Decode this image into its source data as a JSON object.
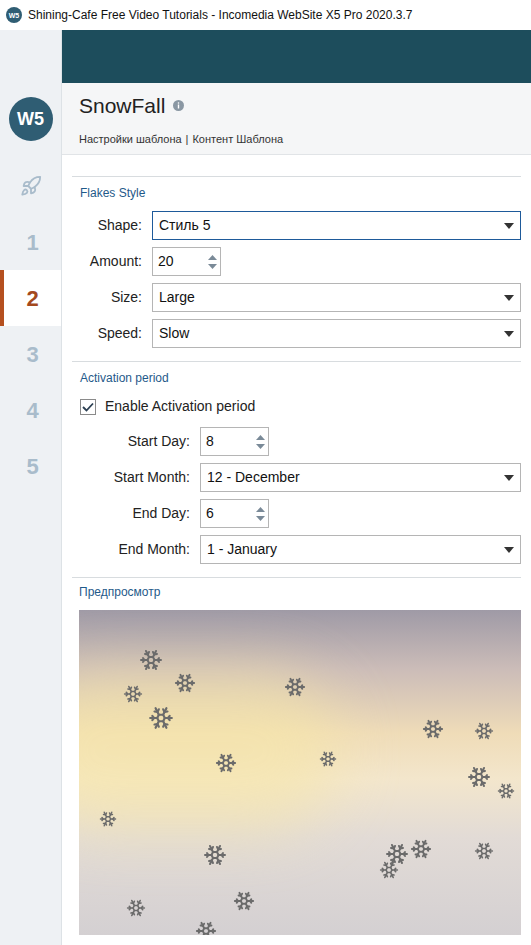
{
  "window": {
    "title": "Shining-Cafe Free Video Tutorials - Incomedia WebSite X5 Pro 2020.3.7"
  },
  "sidebar": {
    "logo": "W5",
    "steps": [
      {
        "label": "1",
        "selected": false
      },
      {
        "label": "2",
        "selected": true
      },
      {
        "label": "3",
        "selected": false
      },
      {
        "label": "4",
        "selected": false
      },
      {
        "label": "5",
        "selected": false
      }
    ]
  },
  "header": {
    "title": "SnowFall",
    "links": [
      "Настройки шаблона",
      "Контент Шаблона"
    ],
    "separator": "|"
  },
  "sections": [
    {
      "title": "Flakes Style",
      "checkbox": null,
      "fields": [
        {
          "kind": "select",
          "label": "Shape:",
          "value": "Стиль 5",
          "focused": true
        },
        {
          "kind": "spinner",
          "label": "Amount:",
          "value": "20",
          "focused": false
        },
        {
          "kind": "select",
          "label": "Size:",
          "value": "Large",
          "focused": false
        },
        {
          "kind": "select",
          "label": "Speed:",
          "value": "Slow",
          "focused": false
        }
      ]
    },
    {
      "title": "Activation period",
      "checkbox": {
        "label": "Enable Activation period",
        "checked": true
      },
      "fields": [
        {
          "kind": "spinner",
          "label": "Start Day:",
          "value": "8",
          "focused": false
        },
        {
          "kind": "select",
          "label": "Start Month:",
          "value": "12 - December",
          "focused": false
        },
        {
          "kind": "spinner",
          "label": "End Day:",
          "value": "6",
          "focused": false
        },
        {
          "kind": "select",
          "label": "End Month:",
          "value": "1 - January",
          "focused": false
        }
      ]
    }
  ],
  "preview": {
    "label": "Предпросмотр"
  }
}
